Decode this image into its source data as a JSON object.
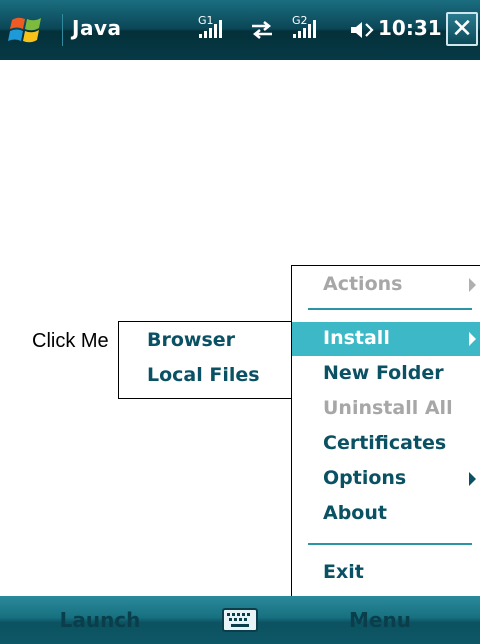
{
  "status_bar": {
    "app_title": "Java",
    "time": "10:31",
    "close_label": "✕",
    "icons": [
      "windows-start-icon",
      "signal-g1-icon",
      "sync-arrows-icon",
      "signal-g2-icon",
      "volume-icon"
    ],
    "signal_1_label": "G1",
    "signal_2_label": "G2"
  },
  "content": {
    "click_label": "Click Me"
  },
  "submenu": {
    "items": [
      {
        "label": "Browser"
      },
      {
        "label": "Local Files"
      }
    ]
  },
  "menu": {
    "items": [
      {
        "label": "Actions",
        "state": "disabled",
        "has_submenu": true
      },
      {
        "label": "Install",
        "state": "selected",
        "has_submenu": true
      },
      {
        "label": "New Folder",
        "state": "enabled"
      },
      {
        "label": "Uninstall All",
        "state": "disabled"
      },
      {
        "label": "Certificates",
        "state": "enabled"
      },
      {
        "label": "Options",
        "state": "enabled",
        "has_submenu": true
      },
      {
        "label": "About",
        "state": "enabled"
      },
      {
        "label": "Exit",
        "state": "enabled"
      }
    ]
  },
  "softkeys": {
    "left": "Launch",
    "right": "Menu",
    "center_icon": "keyboard-icon"
  },
  "colors": {
    "accent": "#0a5164",
    "selected_bg": "#3cb8c7",
    "disabled": "#a7a7a7",
    "title_bar": "#0b4656"
  }
}
